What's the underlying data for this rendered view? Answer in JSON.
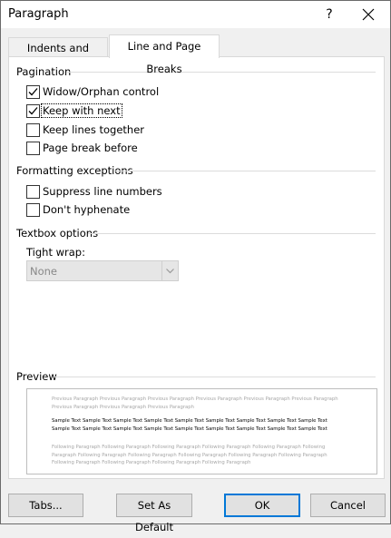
{
  "dialog": {
    "title": "Paragraph",
    "help_label": "?",
    "close_icon": "close-icon"
  },
  "tabs": [
    {
      "label": "Indents and Spacing",
      "selected": false
    },
    {
      "label": "Line and Page Breaks",
      "selected": true
    }
  ],
  "pagination": {
    "heading": "Pagination",
    "options": [
      {
        "label": "Widow/Orphan control",
        "checked": true
      },
      {
        "label": "Keep with next",
        "checked": true
      },
      {
        "label": "Keep lines together",
        "checked": false
      },
      {
        "label": "Page break before",
        "checked": false
      }
    ]
  },
  "formatting": {
    "heading": "Formatting exceptions",
    "options": [
      {
        "label": "Suppress line numbers",
        "checked": false
      },
      {
        "label": "Don't hyphenate",
        "checked": false
      }
    ]
  },
  "textbox": {
    "heading": "Textbox options",
    "tight_wrap_label": "Tight wrap:",
    "tight_wrap_value": "None"
  },
  "preview": {
    "heading": "Preview",
    "previous_text": "Previous Paragraph Previous Paragraph Previous Paragraph Previous Paragraph Previous Paragraph Previous Paragraph Previous Paragraph Previous Paragraph Previous Paragraph",
    "sample_text": "Sample Text Sample Text Sample Text Sample Text Sample Text Sample Text Sample Text Sample Text Sample Text Sample Text Sample Text Sample Text Sample Text Sample Text Sample Text Sample Text Sample Text Sample Text",
    "following_text": "Following Paragraph Following Paragraph Following Paragraph Following Paragraph Following Paragraph Following Paragraph Following Paragraph Following Paragraph Following Paragraph Following Paragraph Following Paragraph Following Paragraph Following Paragraph Following Paragraph Following Paragraph"
  },
  "buttons": {
    "tabs": "Tabs...",
    "set_default": "Set As Default",
    "ok": "OK",
    "cancel": "Cancel"
  }
}
